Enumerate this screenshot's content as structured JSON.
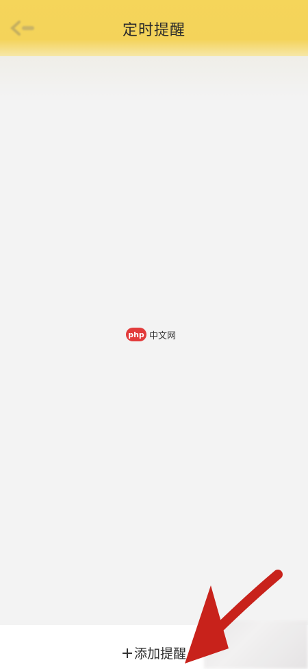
{
  "header": {
    "title": "定时提醒"
  },
  "watermark": {
    "badge": "php",
    "text": "中文网"
  },
  "footer": {
    "add_label": "添加提醒"
  },
  "colors": {
    "header_bg": "#f5d55a",
    "arrow": "#c8221b",
    "text": "#2b2b2b"
  },
  "icons": {
    "back": "back-arrow-icon",
    "add": "plus-icon"
  }
}
